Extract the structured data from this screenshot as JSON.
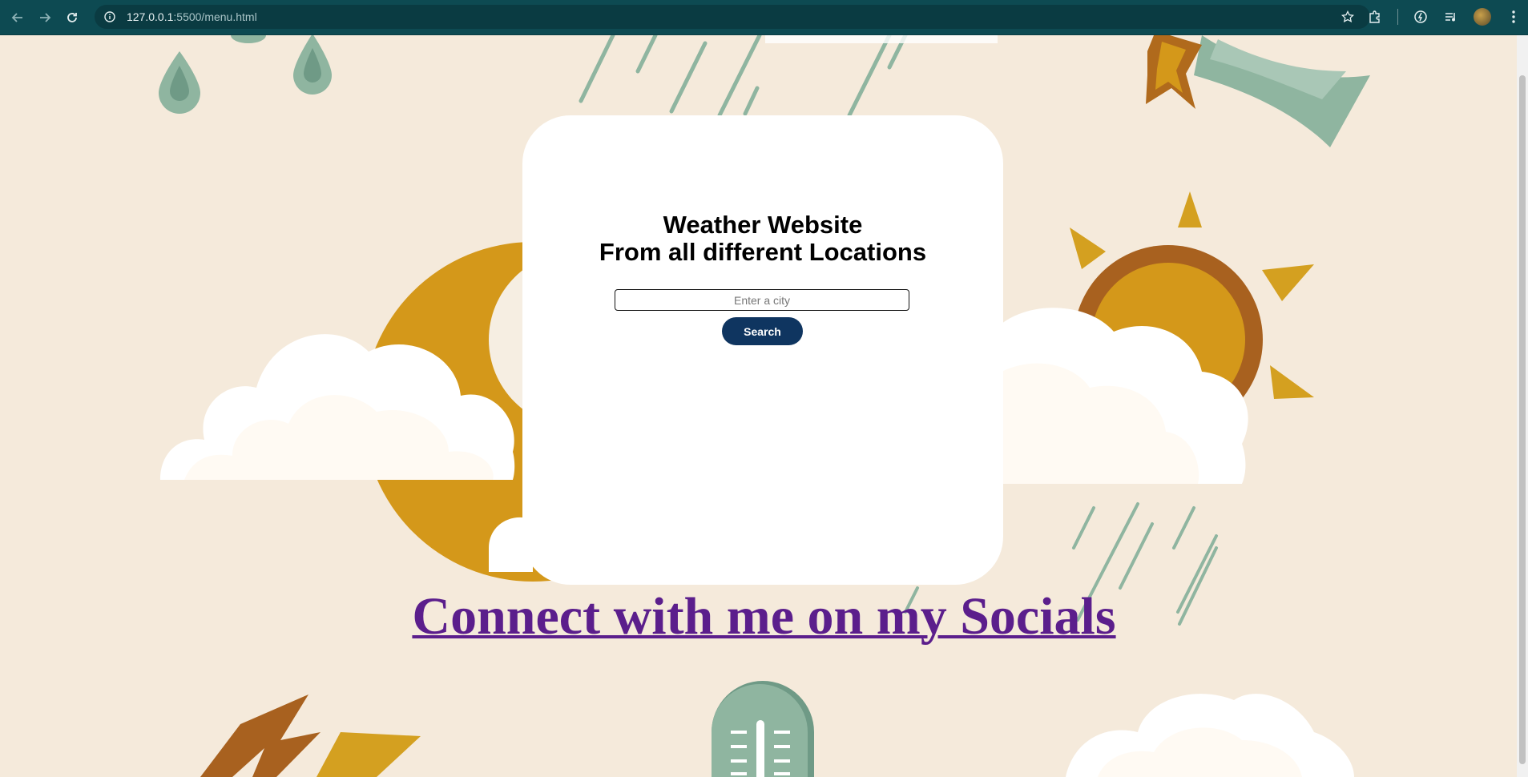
{
  "browser": {
    "url_host": "127.0.0.1",
    "url_rest": ":5500/menu.html",
    "icons": [
      "back-icon",
      "forward-icon",
      "reload-icon",
      "site-info-icon",
      "bookmark-star-icon",
      "extensions-icon",
      "performance-icon",
      "media-controls-icon",
      "profile-avatar",
      "menu-icon"
    ]
  },
  "card": {
    "title_line1": "Weather Website",
    "title_line2": "From all different Locations",
    "search_placeholder": "Enter a city",
    "search_value": "",
    "search_button_label": "Search"
  },
  "footer": {
    "socials_link_text": "Connect with me on my Socials"
  },
  "colors": {
    "browser_bar": "#0d4a52",
    "page_background": "#f5eadb",
    "search_button": "#0f3560",
    "link_color": "#5b1e8c",
    "sun_gold": "#d4981a",
    "sun_ring": "#a8611f",
    "rain_green": "#8fb5a0"
  }
}
